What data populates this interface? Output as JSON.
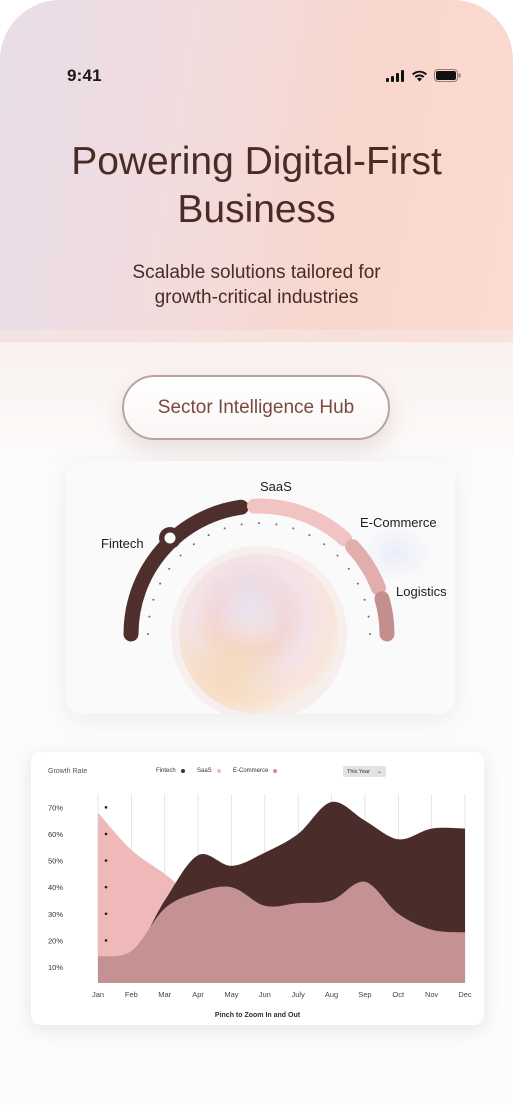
{
  "status_bar": {
    "time": "9:41",
    "icons": [
      "signal-icon",
      "wifi-icon",
      "battery-icon"
    ]
  },
  "hero": {
    "headline_line1": "Powering Digital-First",
    "headline_line2": "Business",
    "subhead_line1": "Scalable solutions tailored for",
    "subhead_line2": "growth-critical industries"
  },
  "hub_button": {
    "label": "Sector Intelligence Hub"
  },
  "dial": {
    "sectors": [
      {
        "label": "Fintech",
        "color": "#4e2f2c",
        "selected": true
      },
      {
        "label": "SaaS",
        "color": "#f1c3c3"
      },
      {
        "label": "E-Commerce",
        "color": "#e2adad"
      },
      {
        "label": "Logistics",
        "color": "#c38e8e"
      }
    ]
  },
  "chart_panel": {
    "title": "Growth Rate",
    "legend": [
      {
        "label": "Fintech",
        "color": "#4a2d2b"
      },
      {
        "label": "SaaS",
        "color": "#f0b9b9"
      },
      {
        "label": "E-Commerce",
        "color": "#c49293"
      }
    ],
    "period_selector": "This Year",
    "footer": "Pinch to Zoom In and Out"
  },
  "chart_data": {
    "type": "area",
    "title": "Growth Rate",
    "categories": [
      "Jan",
      "Feb",
      "Mar",
      "Apr",
      "May",
      "Jun",
      "July",
      "Aug",
      "Sep",
      "Oct",
      "Nov",
      "Dec"
    ],
    "y_ticks": [
      "70%",
      "60%",
      "50%",
      "40%",
      "30%",
      "20%",
      "10%"
    ],
    "ylim": [
      7,
      72
    ],
    "grid": "vertical",
    "legend_position": "top",
    "series": [
      {
        "name": "Fintech",
        "color": "#4a2d2b",
        "values": [
          14,
          14,
          35,
          52,
          48,
          53,
          60,
          72,
          65,
          58,
          62,
          62
        ]
      },
      {
        "name": "SaaS",
        "color": "#f0b9b9",
        "values": [
          68,
          54,
          45,
          35,
          30,
          26,
          24,
          22,
          20,
          18,
          15,
          15
        ]
      },
      {
        "name": "E-Commerce",
        "color": "#c49293",
        "values": [
          14,
          16,
          32,
          38,
          40,
          33,
          34,
          35,
          42,
          30,
          24,
          23
        ]
      }
    ]
  }
}
